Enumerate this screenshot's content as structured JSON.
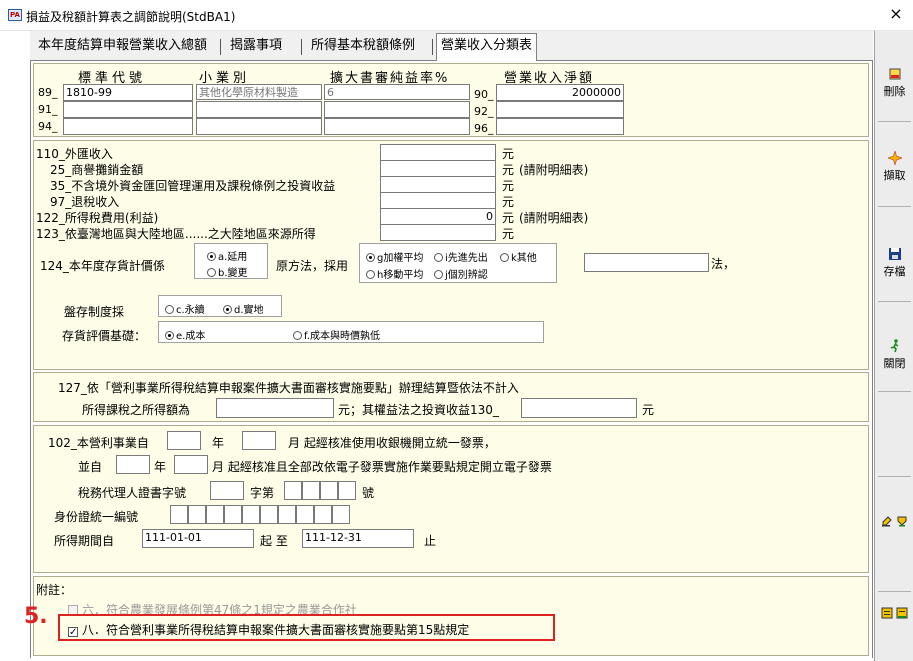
{
  "window": {
    "title": "損益及稅額計算表之調節說明(StdBA1)",
    "close_symbol": "×"
  },
  "tabs": [
    {
      "label": "本年度結算申報營業收入總額"
    },
    {
      "label": "揭露事項"
    },
    {
      "label": "所得基本稅額條例"
    },
    {
      "label": "營業收入分類表",
      "active": true
    }
  ],
  "sidebar": {
    "delete_label": "刪除",
    "fetch_label": "擷取",
    "save_label": "存檔",
    "close_label": "關閉"
  },
  "classification": {
    "headers": {
      "code": "標準代號",
      "category": "小業別",
      "rate": "擴大書審純益率%",
      "revenue": "營業收入淨額"
    },
    "rows": [
      {
        "left_prefix": "89_",
        "code": "1810-99",
        "category": "其他化學原材料製造",
        "rate": "6",
        "right_prefix": "90_",
        "revenue": "2000000"
      },
      {
        "left_prefix": "91_",
        "code": "",
        "category": "",
        "rate": "",
        "right_prefix": "92_",
        "revenue": ""
      },
      {
        "left_prefix": "94_",
        "code": "",
        "category": "",
        "rate": "",
        "right_prefix": "96_",
        "revenue": ""
      }
    ]
  },
  "income_items": [
    {
      "label": "110_外匯收入",
      "value": "",
      "unit": "元",
      "note": ""
    },
    {
      "label": "25_商譽攤銷金額",
      "value": "",
      "unit": "元",
      "note": "(請附明細表)"
    },
    {
      "label": "35_不含境外資金匯回管理運用及課稅條例之投資收益",
      "value": "",
      "unit": "元",
      "note": ""
    },
    {
      "label": "97_退稅收入",
      "value": "",
      "unit": "元",
      "note": ""
    },
    {
      "label": "122_所得稅費用(利益)",
      "value": "0",
      "unit": "元",
      "note": "(請附明細表)"
    },
    {
      "label": "123_依臺灣地區與大陸地區......之大陸地區來源所得",
      "value": "",
      "unit": "元",
      "note": ""
    }
  ],
  "inventory": {
    "label": "124_本年度存貨計價係",
    "opt_a": "a.延用",
    "opt_b": "b.變更",
    "original_label": "原方法，採用",
    "method_g": "g加權平均",
    "method_i": "i先進先出",
    "method_k": "k其他",
    "method_h": "h移動平均",
    "method_j": "j個別辨認",
    "method_suffix": "法，",
    "other_method_value": "",
    "count_label": "盤存制度採",
    "count_c": "c.永續",
    "count_d": "d.實地",
    "valuation_label": "存貨評價基礎：",
    "val_e": "e.成本",
    "val_f": "f.成本與時價孰低"
  },
  "item127": {
    "line1": "127_依「營利事業所得稅結算申報案件擴大書面審核實施要點」辦理結算暨依法不計入",
    "line2_label": "所得課稅之所得額為",
    "line2_mid": "元；其權益法之投資收益130_",
    "line2_unit": "元",
    "amount": "",
    "equity_income": ""
  },
  "invoice": {
    "line1_a": "102_本營利事業自",
    "year_label": "年",
    "line1_b": "月 起經核准使用收銀機開立統一發票，",
    "line2_a": "並自",
    "line2_b": "月 起經核准且全部改依電子發票實施作業要點規定開立電子發票",
    "agent_label": "稅務代理人證書字號",
    "agent_mid": "字第",
    "agent_suffix": "號",
    "id_label": "身份證統一編號",
    "period_label": "所得期間自",
    "period_from": "111-01-01",
    "period_to_label": "起 至",
    "period_to": "111-12-31",
    "period_suffix": "止"
  },
  "notes": {
    "title": "附註：",
    "item6": "六．符合農業發展條例第47條之1規定之農業合作社",
    "item8": "八．符合營利事業所得稅結算申報案件擴大書面審核實施要點第15點規定",
    "item8_checked": true
  },
  "annotation": {
    "step": "5."
  },
  "colors": {
    "panel_bg": "#fefde7",
    "highlight": "#dd2222"
  }
}
